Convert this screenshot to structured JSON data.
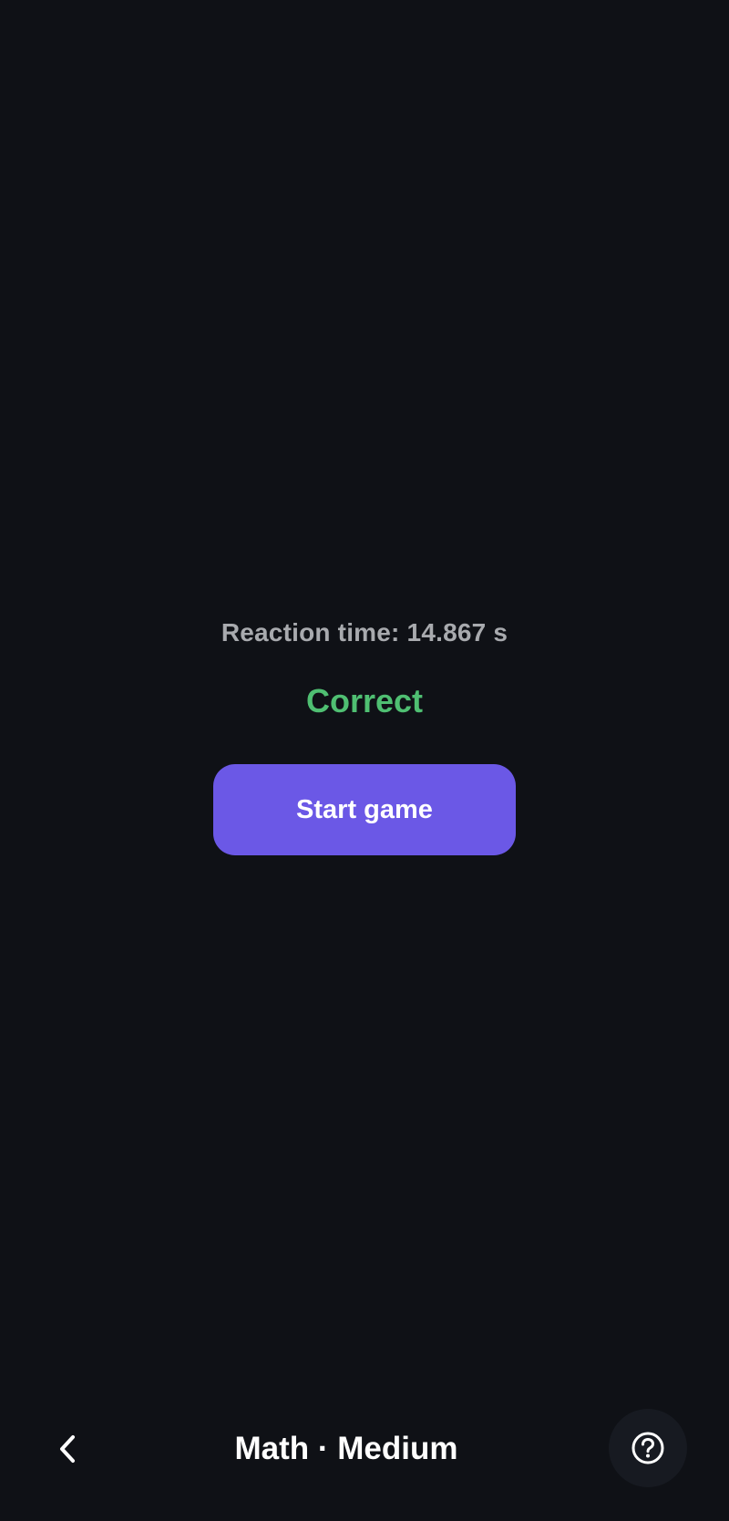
{
  "result": {
    "reaction_label": "Reaction time: 14.867 s",
    "verdict": "Correct",
    "verdict_color": "#4fbf72"
  },
  "actions": {
    "start_label": "Start game",
    "accent_color": "#6b58e6"
  },
  "bottom_bar": {
    "title": "Math · Medium",
    "back_icon": "chevron-left-icon",
    "help_icon": "question-circle-icon"
  }
}
